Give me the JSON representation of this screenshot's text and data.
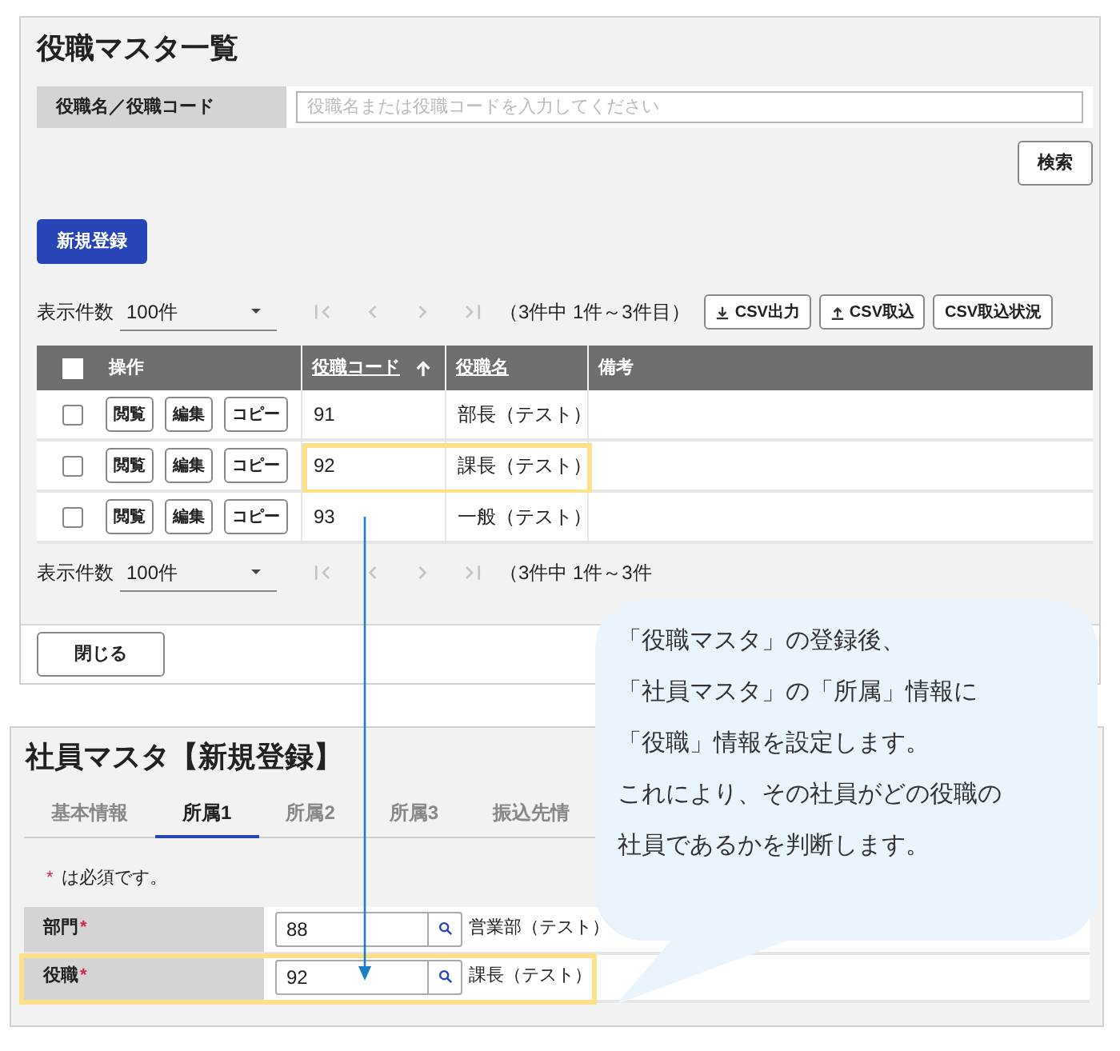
{
  "list_panel": {
    "title": "役職マスタ一覧",
    "search": {
      "label": "役職名／役職コード",
      "placeholder": "役職名または役職コードを入力してください"
    },
    "search_button": "検索",
    "new_button": "新規登録",
    "pager_top": {
      "label": "表示件数",
      "page_size": "100件",
      "summary": "（3件中 1件～3件目）",
      "nav": [
        {
          "kind": "first",
          "disabled": true
        },
        {
          "kind": "prev",
          "disabled": true
        },
        {
          "kind": "next",
          "disabled": true
        },
        {
          "kind": "last",
          "disabled": true
        }
      ]
    },
    "csv_buttons": [
      {
        "label": "CSV出力",
        "kind": "download"
      },
      {
        "label": "CSV取込",
        "kind": "upload"
      },
      {
        "label": "CSV取込状況",
        "kind": "plain"
      }
    ],
    "table": {
      "header_checked": false,
      "columns": [
        {
          "label": "操作",
          "sortable": false
        },
        {
          "label": "役職コード",
          "sortable": true,
          "sort_ascending": true
        },
        {
          "label": "役職名",
          "sortable": true
        },
        {
          "label": "備考",
          "sortable": false
        }
      ],
      "rows": [
        {
          "checked": false,
          "actions": [
            "閲覧",
            "編集",
            "コピー"
          ],
          "code": "91",
          "name": "部長（テスト）",
          "highlighted": false
        },
        {
          "checked": false,
          "actions": [
            "閲覧",
            "編集",
            "コピー"
          ],
          "code": "92",
          "name": "課長（テスト）",
          "highlighted": true
        },
        {
          "checked": false,
          "actions": [
            "閲覧",
            "編集",
            "コピー"
          ],
          "code": "93",
          "name": "一般（テスト）",
          "highlighted": false
        }
      ]
    },
    "pager_bottom": {
      "label": "表示件数",
      "page_size": "100件",
      "summary": "（3件中 1件～3件",
      "nav": [
        {
          "kind": "first",
          "disabled": true
        },
        {
          "kind": "prev",
          "disabled": true
        },
        {
          "kind": "next",
          "disabled": true
        },
        {
          "kind": "last",
          "disabled": true
        }
      ]
    },
    "close_button": "閉じる"
  },
  "form_panel": {
    "title": "社員マスタ【新規登録】",
    "tabs": [
      {
        "label": "基本情報",
        "selected": false
      },
      {
        "label": "所属1",
        "selected": true
      },
      {
        "label": "所属2",
        "selected": false
      },
      {
        "label": "所属3",
        "selected": false
      },
      {
        "label": "振込先情",
        "selected": false
      }
    ],
    "required_note": {
      "mark": "*",
      "text": "は必須です。"
    },
    "fields": [
      {
        "label": "部門",
        "required_mark": "*",
        "value": "88",
        "display": "営業部（テスト）",
        "highlighted": false
      },
      {
        "label": "役職",
        "required_mark": "*",
        "value": "92",
        "display": "課長（テスト）",
        "highlighted": true
      }
    ]
  },
  "callout": {
    "lines": [
      "「役職マスタ」の登録後、",
      "「社員マスタ」の「所属」情報に",
      "「役職」情報を設定します。",
      "これにより、その社員がどの役職の",
      "社員であるかを判断します。"
    ]
  }
}
